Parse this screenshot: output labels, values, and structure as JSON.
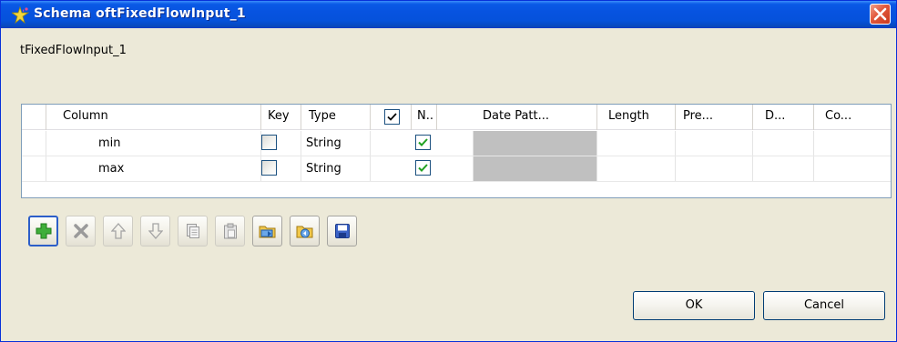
{
  "window": {
    "title": "Schema oftFixedFlowInput_1"
  },
  "schema_label": "tFixedFlowInput_1",
  "table": {
    "columns": [
      "Column",
      "Key",
      "Type",
      "N..",
      "Date Patt...",
      "Length",
      "Pre...",
      "D...",
      "Co..."
    ],
    "header_checkbox_checked": true,
    "rows": [
      {
        "column": "min",
        "key": false,
        "type": "String",
        "nullable": true
      },
      {
        "column": "max",
        "key": false,
        "type": "String",
        "nullable": true
      }
    ]
  },
  "toolbar": {
    "buttons": [
      {
        "icon": "add-icon",
        "enabled": true
      },
      {
        "icon": "delete-icon",
        "enabled": false
      },
      {
        "icon": "move-up-icon",
        "enabled": false
      },
      {
        "icon": "move-down-icon",
        "enabled": false
      },
      {
        "icon": "copy-icon",
        "enabled": false
      },
      {
        "icon": "paste-icon",
        "enabled": false
      },
      {
        "icon": "import-icon",
        "enabled": true
      },
      {
        "icon": "export-icon",
        "enabled": true
      },
      {
        "icon": "save-icon",
        "enabled": true
      }
    ]
  },
  "buttons": {
    "ok": "OK",
    "cancel": "Cancel"
  },
  "colors": {
    "titlebar": "#0753e0",
    "window_bg": "#ece9d8",
    "check_green": "#21a121",
    "close_red": "#e1573a"
  }
}
